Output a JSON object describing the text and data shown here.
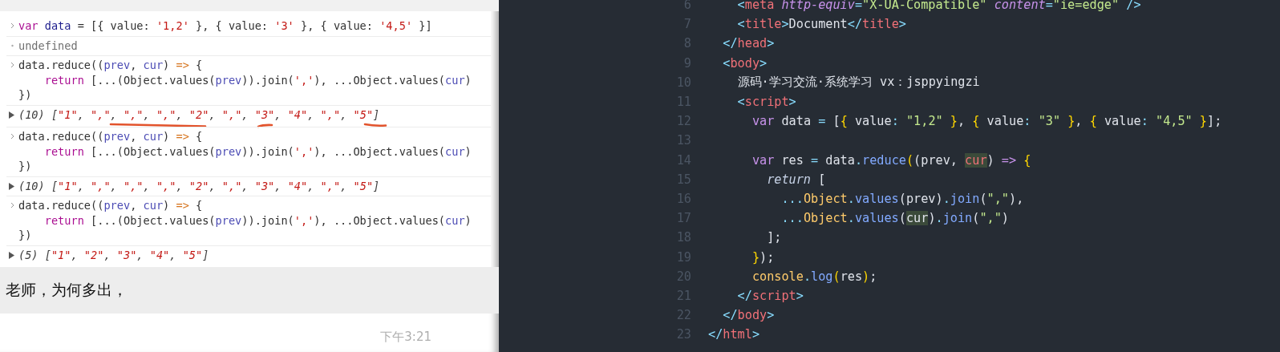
{
  "console": {
    "entries": [
      {
        "kind": "input",
        "lines": [
          [
            {
              "text": "var",
              "kind": "keyword"
            },
            {
              "text": " data",
              "kind": "ident"
            },
            {
              "text": " = [{ value: ",
              "kind": "plain"
            },
            {
              "text": "'1,2'",
              "kind": "string"
            },
            {
              "text": " }, { value: ",
              "kind": "plain"
            },
            {
              "text": "'3'",
              "kind": "string"
            },
            {
              "text": " }, { value: ",
              "kind": "plain"
            },
            {
              "text": "'4,5'",
              "kind": "string"
            },
            {
              "text": " }]",
              "kind": "plain"
            }
          ]
        ]
      },
      {
        "kind": "output",
        "lines": [
          [
            {
              "text": "undefined",
              "kind": "muted"
            }
          ]
        ]
      },
      {
        "kind": "input",
        "lines": [
          [
            {
              "text": "data.reduce((",
              "kind": "plain"
            },
            {
              "text": "prev",
              "kind": "param"
            },
            {
              "text": ", ",
              "kind": "plain"
            },
            {
              "text": "cur",
              "kind": "param"
            },
            {
              "text": ") ",
              "kind": "plain"
            },
            {
              "text": "=>",
              "kind": "arrow"
            },
            {
              "text": " {",
              "kind": "plain"
            }
          ],
          [
            {
              "text": "    return",
              "kind": "keyword"
            },
            {
              "text": " [...(Object.values(",
              "kind": "plain"
            },
            {
              "text": "prev",
              "kind": "param"
            },
            {
              "text": ")).join(",
              "kind": "plain"
            },
            {
              "text": "','",
              "kind": "string"
            },
            {
              "text": "), ...Object.values(",
              "kind": "plain"
            },
            {
              "text": "cur",
              "kind": "param"
            },
            {
              "text": ")",
              "kind": "plain"
            }
          ],
          [
            {
              "text": "})",
              "kind": "plain"
            }
          ]
        ]
      },
      {
        "kind": "result",
        "expanded": false,
        "annotated": true,
        "lines": [
          [
            {
              "text": "(10) [",
              "kind": "count"
            },
            {
              "text": "\"1\"",
              "kind": "string"
            },
            {
              "text": ", ",
              "kind": "punct"
            },
            {
              "text": "\",\"",
              "kind": "string"
            },
            {
              "text": ", ",
              "kind": "punct"
            },
            {
              "text": "\",\"",
              "kind": "string"
            },
            {
              "text": ", ",
              "kind": "punct"
            },
            {
              "text": "\",\"",
              "kind": "string"
            },
            {
              "text": ", ",
              "kind": "punct"
            },
            {
              "text": "\"2\"",
              "kind": "string"
            },
            {
              "text": ", ",
              "kind": "punct"
            },
            {
              "text": "\",\"",
              "kind": "string"
            },
            {
              "text": ", ",
              "kind": "punct"
            },
            {
              "text": "\"3\"",
              "kind": "string"
            },
            {
              "text": ", ",
              "kind": "punct"
            },
            {
              "text": "\"4\"",
              "kind": "string"
            },
            {
              "text": ", ",
              "kind": "punct"
            },
            {
              "text": "\",\"",
              "kind": "string"
            },
            {
              "text": ", ",
              "kind": "punct"
            },
            {
              "text": "\"5\"",
              "kind": "string"
            },
            {
              "text": "]",
              "kind": "punct"
            }
          ]
        ]
      },
      {
        "kind": "input",
        "lines": [
          [
            {
              "text": "data.reduce((",
              "kind": "plain"
            },
            {
              "text": "prev",
              "kind": "param"
            },
            {
              "text": ", ",
              "kind": "plain"
            },
            {
              "text": "cur",
              "kind": "param"
            },
            {
              "text": ") ",
              "kind": "plain"
            },
            {
              "text": "=>",
              "kind": "arrow"
            },
            {
              "text": " {",
              "kind": "plain"
            }
          ],
          [
            {
              "text": "    return",
              "kind": "keyword"
            },
            {
              "text": " [...(Object.values(",
              "kind": "plain"
            },
            {
              "text": "prev",
              "kind": "param"
            },
            {
              "text": ")).join(",
              "kind": "plain"
            },
            {
              "text": "','",
              "kind": "string"
            },
            {
              "text": "), ...Object.values(",
              "kind": "plain"
            },
            {
              "text": "cur",
              "kind": "param"
            },
            {
              "text": ")",
              "kind": "plain"
            }
          ],
          [
            {
              "text": "})",
              "kind": "plain"
            }
          ]
        ]
      },
      {
        "kind": "result",
        "expanded": false,
        "annotated": false,
        "lines": [
          [
            {
              "text": "(10) [",
              "kind": "count"
            },
            {
              "text": "\"1\"",
              "kind": "string"
            },
            {
              "text": ", ",
              "kind": "punct"
            },
            {
              "text": "\",\"",
              "kind": "string"
            },
            {
              "text": ", ",
              "kind": "punct"
            },
            {
              "text": "\",\"",
              "kind": "string"
            },
            {
              "text": ", ",
              "kind": "punct"
            },
            {
              "text": "\",\"",
              "kind": "string"
            },
            {
              "text": ", ",
              "kind": "punct"
            },
            {
              "text": "\"2\"",
              "kind": "string"
            },
            {
              "text": ", ",
              "kind": "punct"
            },
            {
              "text": "\",\"",
              "kind": "string"
            },
            {
              "text": ", ",
              "kind": "punct"
            },
            {
              "text": "\"3\"",
              "kind": "string"
            },
            {
              "text": ", ",
              "kind": "punct"
            },
            {
              "text": "\"4\"",
              "kind": "string"
            },
            {
              "text": ", ",
              "kind": "punct"
            },
            {
              "text": "\",\"",
              "kind": "string"
            },
            {
              "text": ", ",
              "kind": "punct"
            },
            {
              "text": "\"5\"",
              "kind": "string"
            },
            {
              "text": "]",
              "kind": "punct"
            }
          ]
        ]
      },
      {
        "kind": "input",
        "lines": [
          [
            {
              "text": "data.reduce((",
              "kind": "plain"
            },
            {
              "text": "prev",
              "kind": "param"
            },
            {
              "text": ", ",
              "kind": "plain"
            },
            {
              "text": "cur",
              "kind": "param"
            },
            {
              "text": ") ",
              "kind": "plain"
            },
            {
              "text": "=>",
              "kind": "arrow"
            },
            {
              "text": " {",
              "kind": "plain"
            }
          ],
          [
            {
              "text": "    return",
              "kind": "keyword"
            },
            {
              "text": " [...(Object.values(",
              "kind": "plain"
            },
            {
              "text": "prev",
              "kind": "param"
            },
            {
              "text": ")).join(",
              "kind": "plain"
            },
            {
              "text": "','",
              "kind": "string"
            },
            {
              "text": "), ...Object.values(",
              "kind": "plain"
            },
            {
              "text": "cur",
              "kind": "param"
            },
            {
              "text": ")",
              "kind": "plain"
            }
          ],
          [
            {
              "text": "})",
              "kind": "plain"
            }
          ]
        ]
      },
      {
        "kind": "result",
        "expanded": false,
        "annotated": false,
        "lines": [
          [
            {
              "text": "(5) [",
              "kind": "count"
            },
            {
              "text": "\"1\"",
              "kind": "string"
            },
            {
              "text": ", ",
              "kind": "punct"
            },
            {
              "text": "\"2\"",
              "kind": "string"
            },
            {
              "text": ", ",
              "kind": "punct"
            },
            {
              "text": "\"3\"",
              "kind": "string"
            },
            {
              "text": ", ",
              "kind": "punct"
            },
            {
              "text": "\"4\"",
              "kind": "string"
            },
            {
              "text": ", ",
              "kind": "punct"
            },
            {
              "text": "\"5\"",
              "kind": "string"
            },
            {
              "text": "]",
              "kind": "punct"
            }
          ]
        ]
      }
    ]
  },
  "chat": {
    "message": "老师，为何多出，",
    "time": "下午3:21"
  },
  "editor": {
    "lines": [
      {
        "number": "6",
        "tokens": [
          {
            "text": "    <",
            "kind": "punct"
          },
          {
            "text": "meta",
            "kind": "tag"
          },
          {
            "text": " http-equiv",
            "kind": "attr"
          },
          {
            "text": "=",
            "kind": "punct"
          },
          {
            "text": "\"X-UA-Compatible\"",
            "kind": "string"
          },
          {
            "text": " content",
            "kind": "attr"
          },
          {
            "text": "=",
            "kind": "punct"
          },
          {
            "text": "\"ie=edge\"",
            "kind": "string"
          },
          {
            "text": " />",
            "kind": "punct"
          }
        ]
      },
      {
        "number": "7",
        "tokens": [
          {
            "text": "    <",
            "kind": "punct"
          },
          {
            "text": "title",
            "kind": "tag"
          },
          {
            "text": ">",
            "kind": "punct"
          },
          {
            "text": "Document",
            "kind": "plain"
          },
          {
            "text": "</",
            "kind": "punct"
          },
          {
            "text": "title",
            "kind": "tag"
          },
          {
            "text": ">",
            "kind": "punct"
          }
        ]
      },
      {
        "number": "8",
        "tokens": [
          {
            "text": "  </",
            "kind": "punct"
          },
          {
            "text": "head",
            "kind": "tag"
          },
          {
            "text": ">",
            "kind": "punct"
          }
        ]
      },
      {
        "number": "9",
        "tokens": [
          {
            "text": "  <",
            "kind": "punct"
          },
          {
            "text": "body",
            "kind": "tag"
          },
          {
            "text": ">",
            "kind": "punct"
          }
        ]
      },
      {
        "number": "10",
        "tokens": [
          {
            "text": "    源码·学习交流·系统学习 vx：jsppyingzi",
            "kind": "plain"
          }
        ]
      },
      {
        "number": "11",
        "tokens": [
          {
            "text": "    <",
            "kind": "punct"
          },
          {
            "text": "script",
            "kind": "tag"
          },
          {
            "text": ">",
            "kind": "punct"
          }
        ]
      },
      {
        "number": "12",
        "tokens": [
          {
            "text": "      var",
            "kind": "keyword"
          },
          {
            "text": " data ",
            "kind": "plain"
          },
          {
            "text": "=",
            "kind": "punct"
          },
          {
            "text": " [",
            "kind": "plain"
          },
          {
            "text": "{",
            "kind": "brace"
          },
          {
            "text": " value",
            "kind": "plain"
          },
          {
            "text": ":",
            "kind": "punct"
          },
          {
            "text": " \"1,2\" ",
            "kind": "string"
          },
          {
            "text": "}",
            "kind": "brace"
          },
          {
            "text": ", ",
            "kind": "plain"
          },
          {
            "text": "{",
            "kind": "brace"
          },
          {
            "text": " value",
            "kind": "plain"
          },
          {
            "text": ":",
            "kind": "punct"
          },
          {
            "text": " \"3\" ",
            "kind": "string"
          },
          {
            "text": "}",
            "kind": "brace"
          },
          {
            "text": ", ",
            "kind": "plain"
          },
          {
            "text": "{",
            "kind": "brace"
          },
          {
            "text": " value",
            "kind": "plain"
          },
          {
            "text": ":",
            "kind": "punct"
          },
          {
            "text": " \"4,5\" ",
            "kind": "string"
          },
          {
            "text": "}",
            "kind": "brace"
          },
          {
            "text": "];",
            "kind": "plain"
          }
        ]
      },
      {
        "number": "13"
      },
      {
        "number": "14",
        "tokens": [
          {
            "text": "      var",
            "kind": "keyword"
          },
          {
            "text": " res ",
            "kind": "plain"
          },
          {
            "text": "=",
            "kind": "punct"
          },
          {
            "text": " data",
            "kind": "plain"
          },
          {
            "text": ".",
            "kind": "punct"
          },
          {
            "text": "reduce",
            "kind": "func"
          },
          {
            "text": "(",
            "kind": "brace"
          },
          {
            "text": "(prev, ",
            "kind": "plain"
          },
          {
            "text": "cur",
            "kind": "param",
            "highlighted": true
          },
          {
            "text": ") ",
            "kind": "plain"
          },
          {
            "text": "=>",
            "kind": "keyword"
          },
          {
            "text": " {",
            "kind": "brace"
          }
        ]
      },
      {
        "number": "15",
        "tokens": [
          {
            "text": "        return",
            "kind": "ret"
          },
          {
            "text": " [",
            "kind": "plain"
          }
        ]
      },
      {
        "number": "16",
        "tokens": [
          {
            "text": "          ...",
            "kind": "punct"
          },
          {
            "text": "Object",
            "kind": "class"
          },
          {
            "text": ".",
            "kind": "punct"
          },
          {
            "text": "values",
            "kind": "func"
          },
          {
            "text": "(prev)",
            "kind": "plain"
          },
          {
            "text": ".",
            "kind": "punct"
          },
          {
            "text": "join",
            "kind": "func"
          },
          {
            "text": "(",
            "kind": "plain"
          },
          {
            "text": "\",\"",
            "kind": "string"
          },
          {
            "text": "),",
            "kind": "plain"
          }
        ]
      },
      {
        "number": "17",
        "tokens": [
          {
            "text": "          ...",
            "kind": "punct"
          },
          {
            "text": "Object",
            "kind": "class"
          },
          {
            "text": ".",
            "kind": "punct"
          },
          {
            "text": "values",
            "kind": "func"
          },
          {
            "text": "(",
            "kind": "plain"
          },
          {
            "text": "cur",
            "kind": "plain",
            "highlighted": true
          },
          {
            "text": ")",
            "kind": "plain"
          },
          {
            "text": ".",
            "kind": "punct"
          },
          {
            "text": "join",
            "kind": "func"
          },
          {
            "text": "(",
            "kind": "plain"
          },
          {
            "text": "\",\"",
            "kind": "string"
          },
          {
            "text": ")",
            "kind": "plain"
          }
        ]
      },
      {
        "number": "18",
        "tokens": [
          {
            "text": "        ];",
            "kind": "plain"
          }
        ]
      },
      {
        "number": "19",
        "tokens": [
          {
            "text": "      }",
            "kind": "brace"
          },
          {
            "text": ");",
            "kind": "plain"
          }
        ]
      },
      {
        "number": "20",
        "tokens": [
          {
            "text": "      console",
            "kind": "class"
          },
          {
            "text": ".",
            "kind": "punct"
          },
          {
            "text": "log",
            "kind": "func"
          },
          {
            "text": "(",
            "kind": "brace"
          },
          {
            "text": "res",
            "kind": "plain"
          },
          {
            "text": ")",
            "kind": "brace"
          },
          {
            "text": ";",
            "kind": "plain"
          }
        ]
      },
      {
        "number": "21",
        "tokens": [
          {
            "text": "    </",
            "kind": "punct"
          },
          {
            "text": "script",
            "kind": "tag"
          },
          {
            "text": ">",
            "kind": "punct"
          }
        ]
      },
      {
        "number": "22",
        "tokens": [
          {
            "text": "  </",
            "kind": "punct"
          },
          {
            "text": "body",
            "kind": "tag"
          },
          {
            "text": ">",
            "kind": "punct"
          }
        ]
      },
      {
        "number": "23",
        "tokens": [
          {
            "text": "</",
            "kind": "punct"
          },
          {
            "text": "html",
            "kind": "tag"
          },
          {
            "text": ">",
            "kind": "punct"
          }
        ]
      }
    ]
  }
}
